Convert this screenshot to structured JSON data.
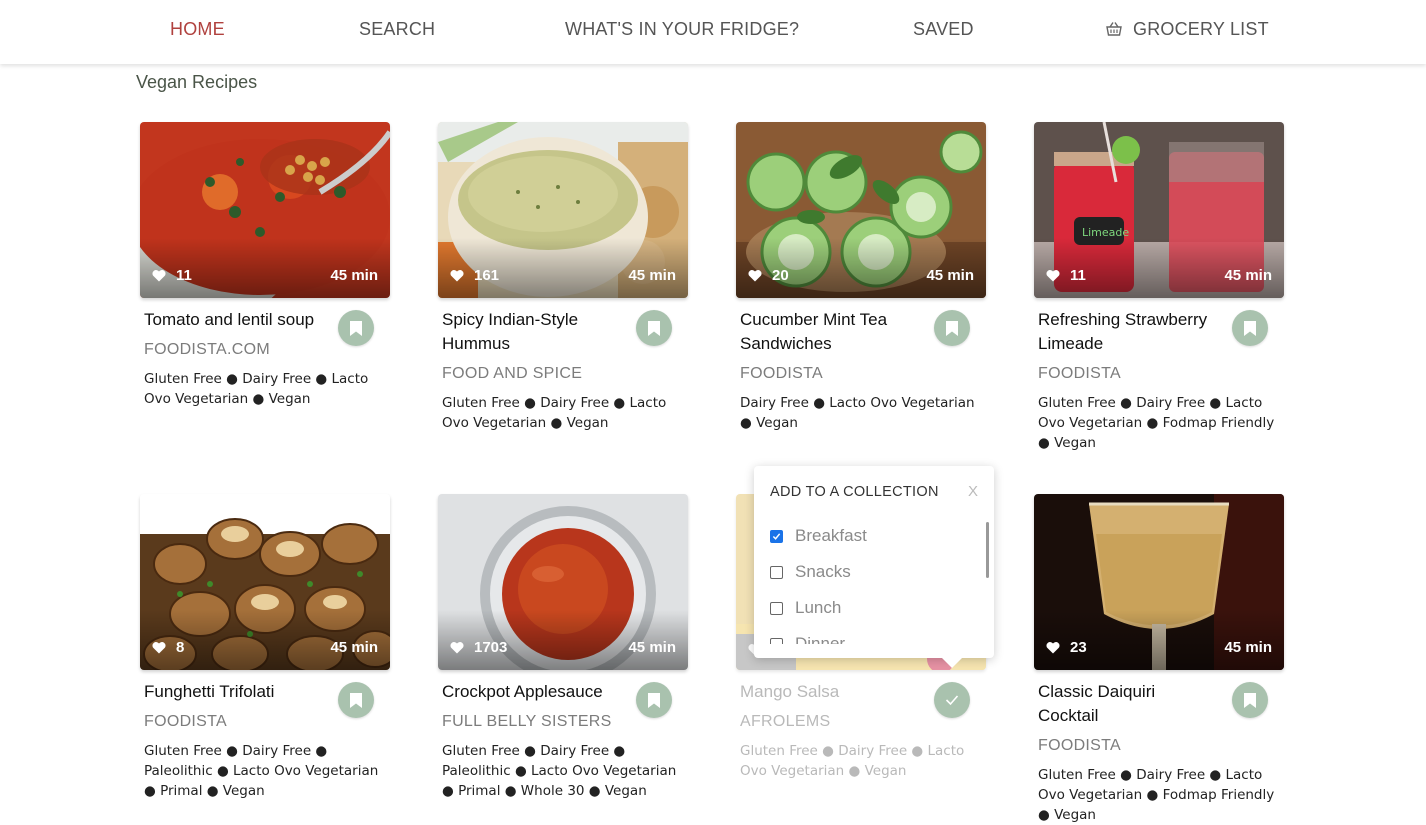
{
  "nav": {
    "items": [
      {
        "label": "HOME",
        "active": true
      },
      {
        "label": "SEARCH",
        "active": false
      },
      {
        "label": "WHAT'S IN YOUR FRIDGE?",
        "active": false
      },
      {
        "label": "SAVED",
        "active": false
      },
      {
        "label": "GROCERY LIST",
        "active": false,
        "icon": "basket-icon"
      }
    ]
  },
  "page": {
    "title": "Vegan Recipes"
  },
  "recipes": [
    {
      "title": "Tomato and lentil soup",
      "source": "FOODISTA.COM",
      "likes": "11",
      "time": "45 min",
      "tags": "Gluten Free ● Dairy Free ● Lacto Ovo Vegetarian ● Vegan",
      "saved": false
    },
    {
      "title": "Spicy Indian-Style Hummus",
      "source": "FOOD AND SPICE",
      "likes": "161",
      "time": "45 min",
      "tags": "Gluten Free ● Dairy Free ● Lacto Ovo Vegetarian ● Vegan",
      "saved": false
    },
    {
      "title": "Cucumber Mint Tea Sandwiches",
      "source": "FOODISTA",
      "likes": "20",
      "time": "45 min",
      "tags": "Dairy Free ● Lacto Ovo Vegetarian ● Vegan",
      "saved": false
    },
    {
      "title": "Refreshing Strawberry Limeade",
      "source": "FOODISTA",
      "likes": "11",
      "time": "45 min",
      "tags": "Gluten Free ● Dairy Free ● Lacto Ovo Vegetarian ● Fodmap Friendly ● Vegan",
      "saved": false
    },
    {
      "title": "Funghetti Trifolati",
      "source": "FOODISTA",
      "likes": "8",
      "time": "45 min",
      "tags": "Gluten Free ● Dairy Free ● Paleolithic ● Lacto Ovo Vegetarian ● Primal ● Vegan",
      "saved": false
    },
    {
      "title": "Crockpot Applesauce",
      "source": "FULL BELLY SISTERS",
      "likes": "1703",
      "time": "45 min",
      "tags": "Gluten Free ● Dairy Free ● Paleolithic ● Lacto Ovo Vegetarian ● Primal ● Whole 30 ● Vegan",
      "saved": false
    },
    {
      "title": "Mango Salsa",
      "source": "AFROLEMS",
      "likes": "",
      "time": "",
      "tags": "Gluten Free ● Dairy Free ● Lacto Ovo Vegetarian ● Vegan",
      "saved": true
    },
    {
      "title": "Classic Daiquiri Cocktail",
      "source": "FOODISTA",
      "likes": "23",
      "time": "45 min",
      "tags": "Gluten Free ● Dairy Free ● Lacto Ovo Vegetarian ● Fodmap Friendly ● Vegan",
      "saved": false
    }
  ],
  "collection_popup": {
    "title": "ADD TO A COLLECTION",
    "close_label": "X",
    "options": [
      {
        "label": "Breakfast",
        "checked": true
      },
      {
        "label": "Snacks",
        "checked": false
      },
      {
        "label": "Lunch",
        "checked": false
      },
      {
        "label": "Dinner",
        "checked": false
      }
    ]
  },
  "colors": {
    "nav_active": "#b0413e",
    "bookmark_button": "#a9c2ae",
    "checkbox_checked": "#1a73e8"
  }
}
